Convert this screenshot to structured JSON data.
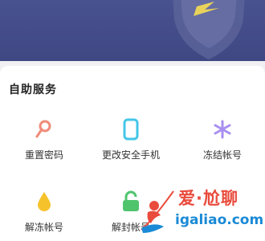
{
  "section": {
    "title": "自助服务"
  },
  "services": [
    {
      "label": "重置密码",
      "icon": "key-icon",
      "color": "#ef8c7a"
    },
    {
      "label": "更改安全手机",
      "icon": "phone-icon",
      "color": "#43c6e8"
    },
    {
      "label": "冻结帐号",
      "icon": "snowflake-icon",
      "color": "#a88ff0"
    },
    {
      "label": "解冻帐号",
      "icon": "water-drop-icon",
      "color": "#f6c22c"
    },
    {
      "label": "解封帐号",
      "icon": "unlock-icon",
      "color": "#4fc46d"
    }
  ],
  "watermark": {
    "text": "爱·尬聊",
    "url": "igaliao.com"
  },
  "colors": {
    "banner": "#434c88",
    "accent_red": "#e94b3c",
    "accent_blue": "#1a8ad6"
  }
}
